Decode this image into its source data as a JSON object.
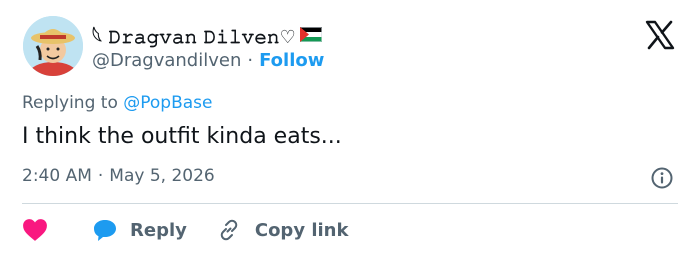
{
  "author": {
    "display_name": "𓆩 𝙳𝚛𝚊𝚐𝚟𝚊𝚗 𝙳𝚒𝚕𝚟𝚎𝚗♡",
    "flag_icon": "palestine-flag-icon",
    "handle": "@Dragvandilven",
    "separator": "·",
    "follow_label": "Follow"
  },
  "tweet": {
    "replying_prefix": "Replying to",
    "replying_to": "@PopBase",
    "text": "I think the outfit kinda eats...",
    "time": "2:40 AM",
    "date_separator": "·",
    "date": "May 5, 2026"
  },
  "actions": {
    "like_count": "",
    "reply_label": "Reply",
    "copy_link_label": "Copy link"
  },
  "colors": {
    "accent": "#1d9bf0",
    "like": "#f91880",
    "muted": "#536471",
    "text": "#0f1419",
    "divider": "#cfd9de"
  },
  "icons": [
    "x-logo-icon",
    "info-icon",
    "heart-icon",
    "reply-bubble-icon",
    "link-icon"
  ]
}
